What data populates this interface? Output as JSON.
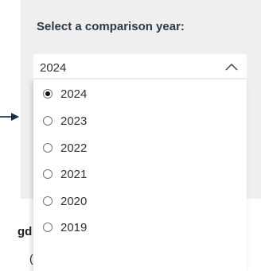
{
  "panel": {
    "heading": "Select a comparison year:"
  },
  "select": {
    "value": "2024"
  },
  "options": [
    {
      "label": "2024",
      "checked": true
    },
    {
      "label": "2023",
      "checked": false
    },
    {
      "label": "2022",
      "checked": false
    },
    {
      "label": "2021",
      "checked": false
    },
    {
      "label": "2020",
      "checked": false
    },
    {
      "label": "2019",
      "checked": false
    }
  ],
  "background": {
    "fragment_1": "gd",
    "fragment_2": "("
  },
  "colors": {
    "heading": "#2b3a4a",
    "panel_bg": "#efefef",
    "arrow": "#1e2a4a"
  },
  "icons": {
    "chevron": "chevron-up-icon",
    "arrow": "arrow-right-icon"
  }
}
